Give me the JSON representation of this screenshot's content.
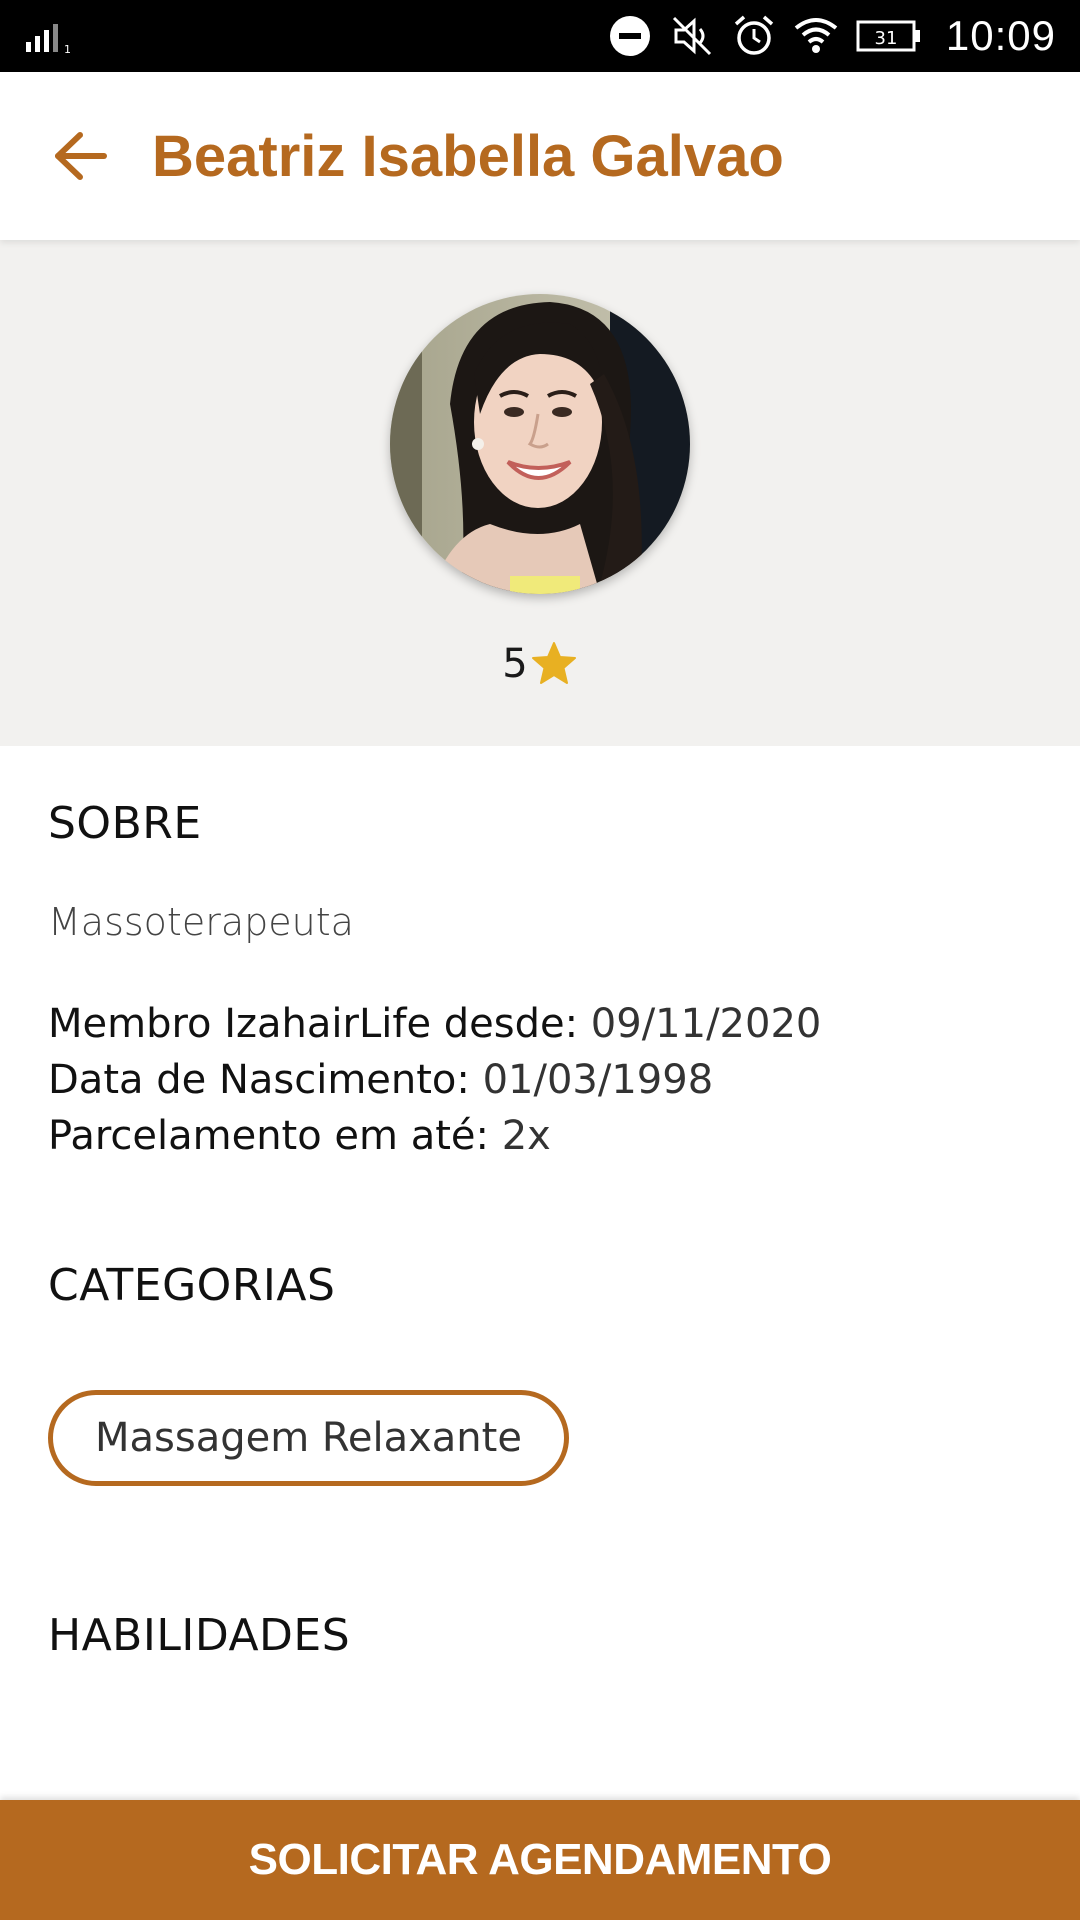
{
  "status_bar": {
    "time": "10:09",
    "battery": "31"
  },
  "app_bar": {
    "title": "Beatriz Isabella Galvao",
    "back_icon": "arrow-left-icon"
  },
  "profile": {
    "rating": "5",
    "rating_icon": "star-icon"
  },
  "about": {
    "title": "SOBRE",
    "role": "Massoterapeuta",
    "member_since_label": "Membro IzahairLife desde:",
    "member_since_value": "09/11/2020",
    "birth_label": "Data de Nascimento:",
    "birth_value": "01/03/1998",
    "installments_label": "Parcelamento em até:",
    "installments_value": "2x"
  },
  "categories": {
    "title": "CATEGORIAS",
    "items": [
      "Massagem Relaxante"
    ]
  },
  "skills": {
    "title": "HABILIDADES"
  },
  "cta": {
    "label": "SOLICITAR AGENDAMENTO"
  },
  "colors": {
    "accent": "#b5691f",
    "header_bg": "#f2f1ef",
    "star": "#e8b022"
  }
}
